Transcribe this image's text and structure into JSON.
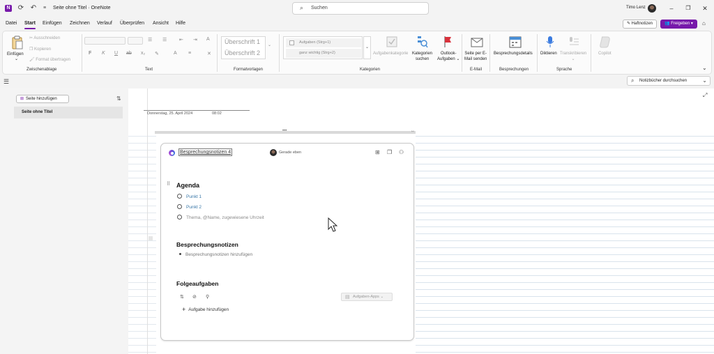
{
  "titlebar": {
    "title": "Seite ohne Titel  ·  OneNote",
    "search_placeholder": "Suchen",
    "user_name": "Timo Lenz",
    "app_letter": "N"
  },
  "menu": {
    "tabs": [
      "Datei",
      "Start",
      "Einfügen",
      "Zeichnen",
      "Verlauf",
      "Überprüfen",
      "Ansicht",
      "Hilfe"
    ],
    "active": "Start",
    "haftnotizen": "Haftnotizen",
    "freigeben": "Freigeben"
  },
  "ribbon": {
    "clipboard": {
      "paste": "Einfügen",
      "cut": "Ausschneiden",
      "copy": "Kopieren",
      "format_painter": "Format übertragen",
      "group": "Zwischenablage"
    },
    "text": {
      "group": "Text",
      "bold": "F",
      "italic": "K",
      "underline": "U"
    },
    "styles": {
      "heading1": "Überschrift 1",
      "heading2": "Überschrift 2",
      "group": "Formatvorlagen"
    },
    "tags": {
      "item1": "Aufgaben (Strg+1)",
      "item2": "ganz wichtig (Strg+2)",
      "task_tag": "Aufgabenkategorie",
      "find_tags_1": "Kategorien",
      "find_tags_2": "suchen",
      "outlook_1": "Outlook-",
      "outlook_2": "Aufgaben",
      "group": "Kategorien"
    },
    "email": {
      "send_1": "Seite per E-",
      "send_2": "Mail senden",
      "group": "E-Mail"
    },
    "meetings": {
      "details": "Besprechungsdetails",
      "group": "Besprechungen"
    },
    "voice": {
      "dictate": "Diktieren",
      "transcribe": "Transkribieren",
      "group": "Sprache"
    },
    "copilot": "Copilot"
  },
  "nav": {
    "notebook_search": "Notizbücher durchsuchen"
  },
  "pages": {
    "add_page": "Seite hinzufügen",
    "items": [
      "Seite ohne Titel"
    ]
  },
  "page": {
    "date": "Donnerstag, 25. April 2024",
    "time": "08:02"
  },
  "card": {
    "title": "Besprechungsnotizen 4",
    "status": "Gerade eben",
    "agenda_heading": "Agenda",
    "agenda_items": [
      "Punkt 1",
      "Punkt 2"
    ],
    "agenda_placeholder": "Thema, @Name, zugewiesene Uhrzeit",
    "notes_heading": "Besprechungsnotizen",
    "notes_placeholder": "Besprechungsnotizen hinzufügen",
    "followup_heading": "Folgeaufgaben",
    "add_task": "Aufgabe hinzufügen",
    "task_apps": "Aufgaben-Apps"
  },
  "colors": {
    "accent": "#7719aa",
    "link": "#3a78a8"
  }
}
